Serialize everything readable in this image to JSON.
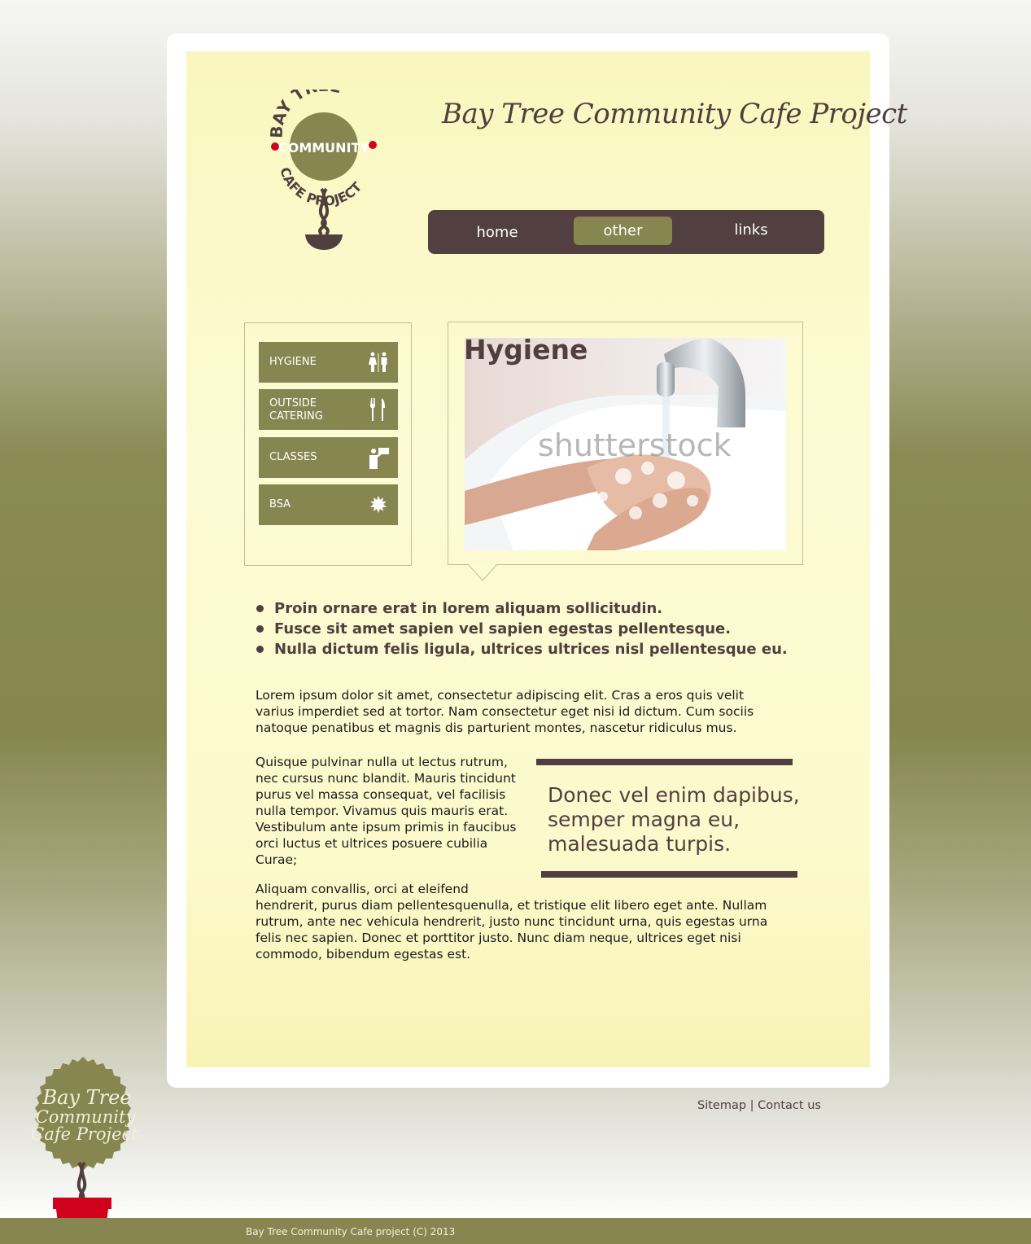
{
  "site": {
    "title": "Bay Tree Community Cafe Project",
    "logo_text": {
      "top": "BAY TREE",
      "middle": "COMMUNITY",
      "bottom": "CAFE PROJECT"
    }
  },
  "nav": {
    "items": [
      {
        "label": "home",
        "active": false
      },
      {
        "label": "other",
        "active": true
      },
      {
        "label": "links",
        "active": false
      }
    ]
  },
  "sidebar": {
    "items": [
      {
        "label": "HYGIENE",
        "icon": "restroom-icon"
      },
      {
        "label_line1": "OUTSIDE",
        "label_line2": "CATERING",
        "icon": "cutlery-icon"
      },
      {
        "label": "CLASSES",
        "icon": "teacher-icon"
      },
      {
        "label": "BSA",
        "icon": "starburst-icon"
      }
    ]
  },
  "feature": {
    "title": "Hygiene",
    "photo_watermark": "shutterstock"
  },
  "bullets": [
    "Proin ornare erat in lorem aliquam sollicitudin.",
    "Fusce sit amet sapien vel sapien egestas pellentesque.",
    "Nulla dictum felis ligula, ultrices ultrices nisl pellentesque eu."
  ],
  "paragraphs": {
    "p1": "Lorem ipsum dolor sit amet, consectetur adipiscing elit. Cras a eros quis velit varius imperdiet sed at tortor. Nam consectetur eget nisi id dictum. Cum sociis natoque penatibus et magnis dis parturient montes, nascetur ridiculus mus.",
    "p2": "Quisque pulvinar nulla ut lectus rutrum, nec cursus nunc blandit. Mauris  tincidunt purus vel massa consequat, vel facilisis nulla tempor. Vivamus quis  mauris erat. Vestibulum ante ipsum primis in faucibus orci luctus et ultrices posuere cubilia Curae;",
    "p3_line1": "Aliquam convallis, orci at eleifend",
    "p3_rest": "hendrerit, purus diam pellentesquenulla, et tristique elit libero eget ante. Nullam rutrum, ante nec vehicula hendrerit, justo nunc tincidunt urna, quis egestas urna felis nec sapien. Donec et porttitor justo. Nunc diam neque, ultrices eget nisi commodo, bibendum egestas est."
  },
  "pull_quote": "Donec vel enim dapibus, semper magna eu, malesuada turpis.",
  "footer": {
    "sitemap": "Sitemap",
    "separator": " | ",
    "contact": "Contact us",
    "copyright": "Bay Tree Community Cafe project (C) 2013"
  },
  "badge": {
    "line1": "Bay Tree",
    "line2": "Community",
    "line3": "Cafe Project"
  },
  "colors": {
    "olive": "#878650",
    "brown": "#523f40",
    "paper": "#fdfbd4",
    "red": "#d0021b"
  }
}
